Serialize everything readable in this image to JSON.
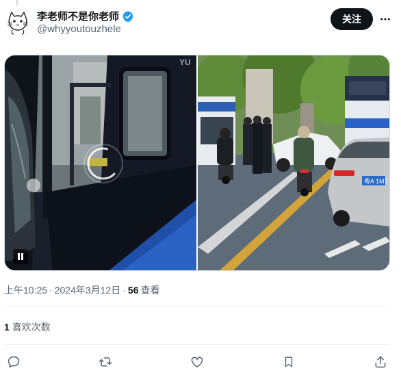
{
  "author": {
    "display_name": "李老师不是你老师",
    "handle": "@whyyoutouzhele",
    "avatar_icon": "cat-sketch-avatar",
    "verified_icon": "verified-badge-icon",
    "verified_color": "#1d9bf0"
  },
  "header": {
    "follow_label": "关注",
    "more_icon": "more-horizontal-icon"
  },
  "media": {
    "left_type": "video",
    "right_type": "image",
    "pause_icon": "pause-icon",
    "bus_sign_text": "YU",
    "plate_text": "粤A 1M7"
  },
  "meta": {
    "time": "上午10:25",
    "separator": "·",
    "date": "2024年3月12日",
    "views_count": "56",
    "views_label": "查看"
  },
  "likes": {
    "count": "1",
    "label": "喜欢次数"
  },
  "actions": [
    {
      "name": "reply-icon"
    },
    {
      "name": "retweet-icon"
    },
    {
      "name": "like-icon"
    },
    {
      "name": "bookmark-icon"
    },
    {
      "name": "share-icon"
    }
  ],
  "colors": {
    "text_primary": "#0f1419",
    "text_secondary": "#536471",
    "follow_button_bg": "#0f1419",
    "divider": "#eff3f4"
  }
}
